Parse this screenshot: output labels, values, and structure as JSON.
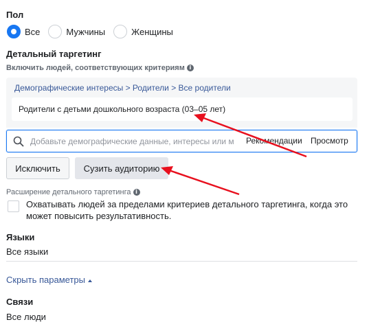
{
  "gender": {
    "title": "Пол",
    "options": [
      {
        "label": "Все",
        "selected": true
      },
      {
        "label": "Мужчины",
        "selected": false
      },
      {
        "label": "Женщины",
        "selected": false
      }
    ]
  },
  "detailed_targeting": {
    "title": "Детальный таргетинг",
    "subtitle": "Включить людей, соответствующих критериям",
    "breadcrumb": "Демографические интересы > Родители > Все родители",
    "selected_item": "Родители с детьми дошкольного возраста (03–05 лет)",
    "search_placeholder": "Добавьте демографические данные, интересы или м",
    "recommendations": "Рекомендации",
    "browse": "Просмотр",
    "exclude_button": "Исключить",
    "narrow_button": "Сузить аудиторию"
  },
  "expansion": {
    "title": "Расширение детального таргетинга",
    "checkbox_text": "Охватывать людей за пределами критериев детального таргетинга, когда это может повысить результативность.",
    "checked": false
  },
  "languages": {
    "title": "Языки",
    "value": "Все языки"
  },
  "hide_params": "Скрыть параметры",
  "connections": {
    "title": "Связи",
    "value": "Все люди"
  },
  "colors": {
    "accent": "#1877f2",
    "link": "#385898",
    "arrow": "#e8101e"
  }
}
